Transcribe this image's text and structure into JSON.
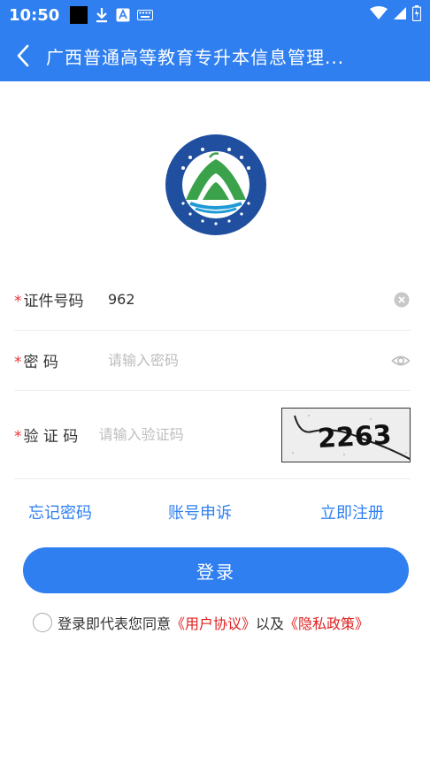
{
  "status_bar": {
    "time": "10:50",
    "icons": [
      "black-square",
      "download-icon",
      "translate-icon",
      "keyboard-icon",
      "wifi-icon",
      "signal-icon",
      "battery-icon"
    ]
  },
  "app_bar": {
    "title": "广西普通高等教育专升本信息管理..."
  },
  "form": {
    "id_label": "证件号码",
    "id_value": "962",
    "password_label": "密 码",
    "password_placeholder": "请输入密码",
    "captcha_label": "验 证 码",
    "captcha_placeholder": "请输入验证码",
    "captcha_text": "2263",
    "required_mark": "*"
  },
  "links": {
    "forgot": "忘记密码",
    "appeal": "账号申诉",
    "register": "立即注册"
  },
  "login_button": "登录",
  "agreement": {
    "prefix": "登录即代表您同意",
    "user_agreement": "《用户协议》",
    "middle": "以及",
    "privacy_policy": "《隐私政策》"
  },
  "colors": {
    "primary": "#2f7ff0",
    "required": "#e33333",
    "link_red": "#e02020",
    "logo_blue": "#1f4f9e",
    "logo_green": "#3aa24a"
  }
}
